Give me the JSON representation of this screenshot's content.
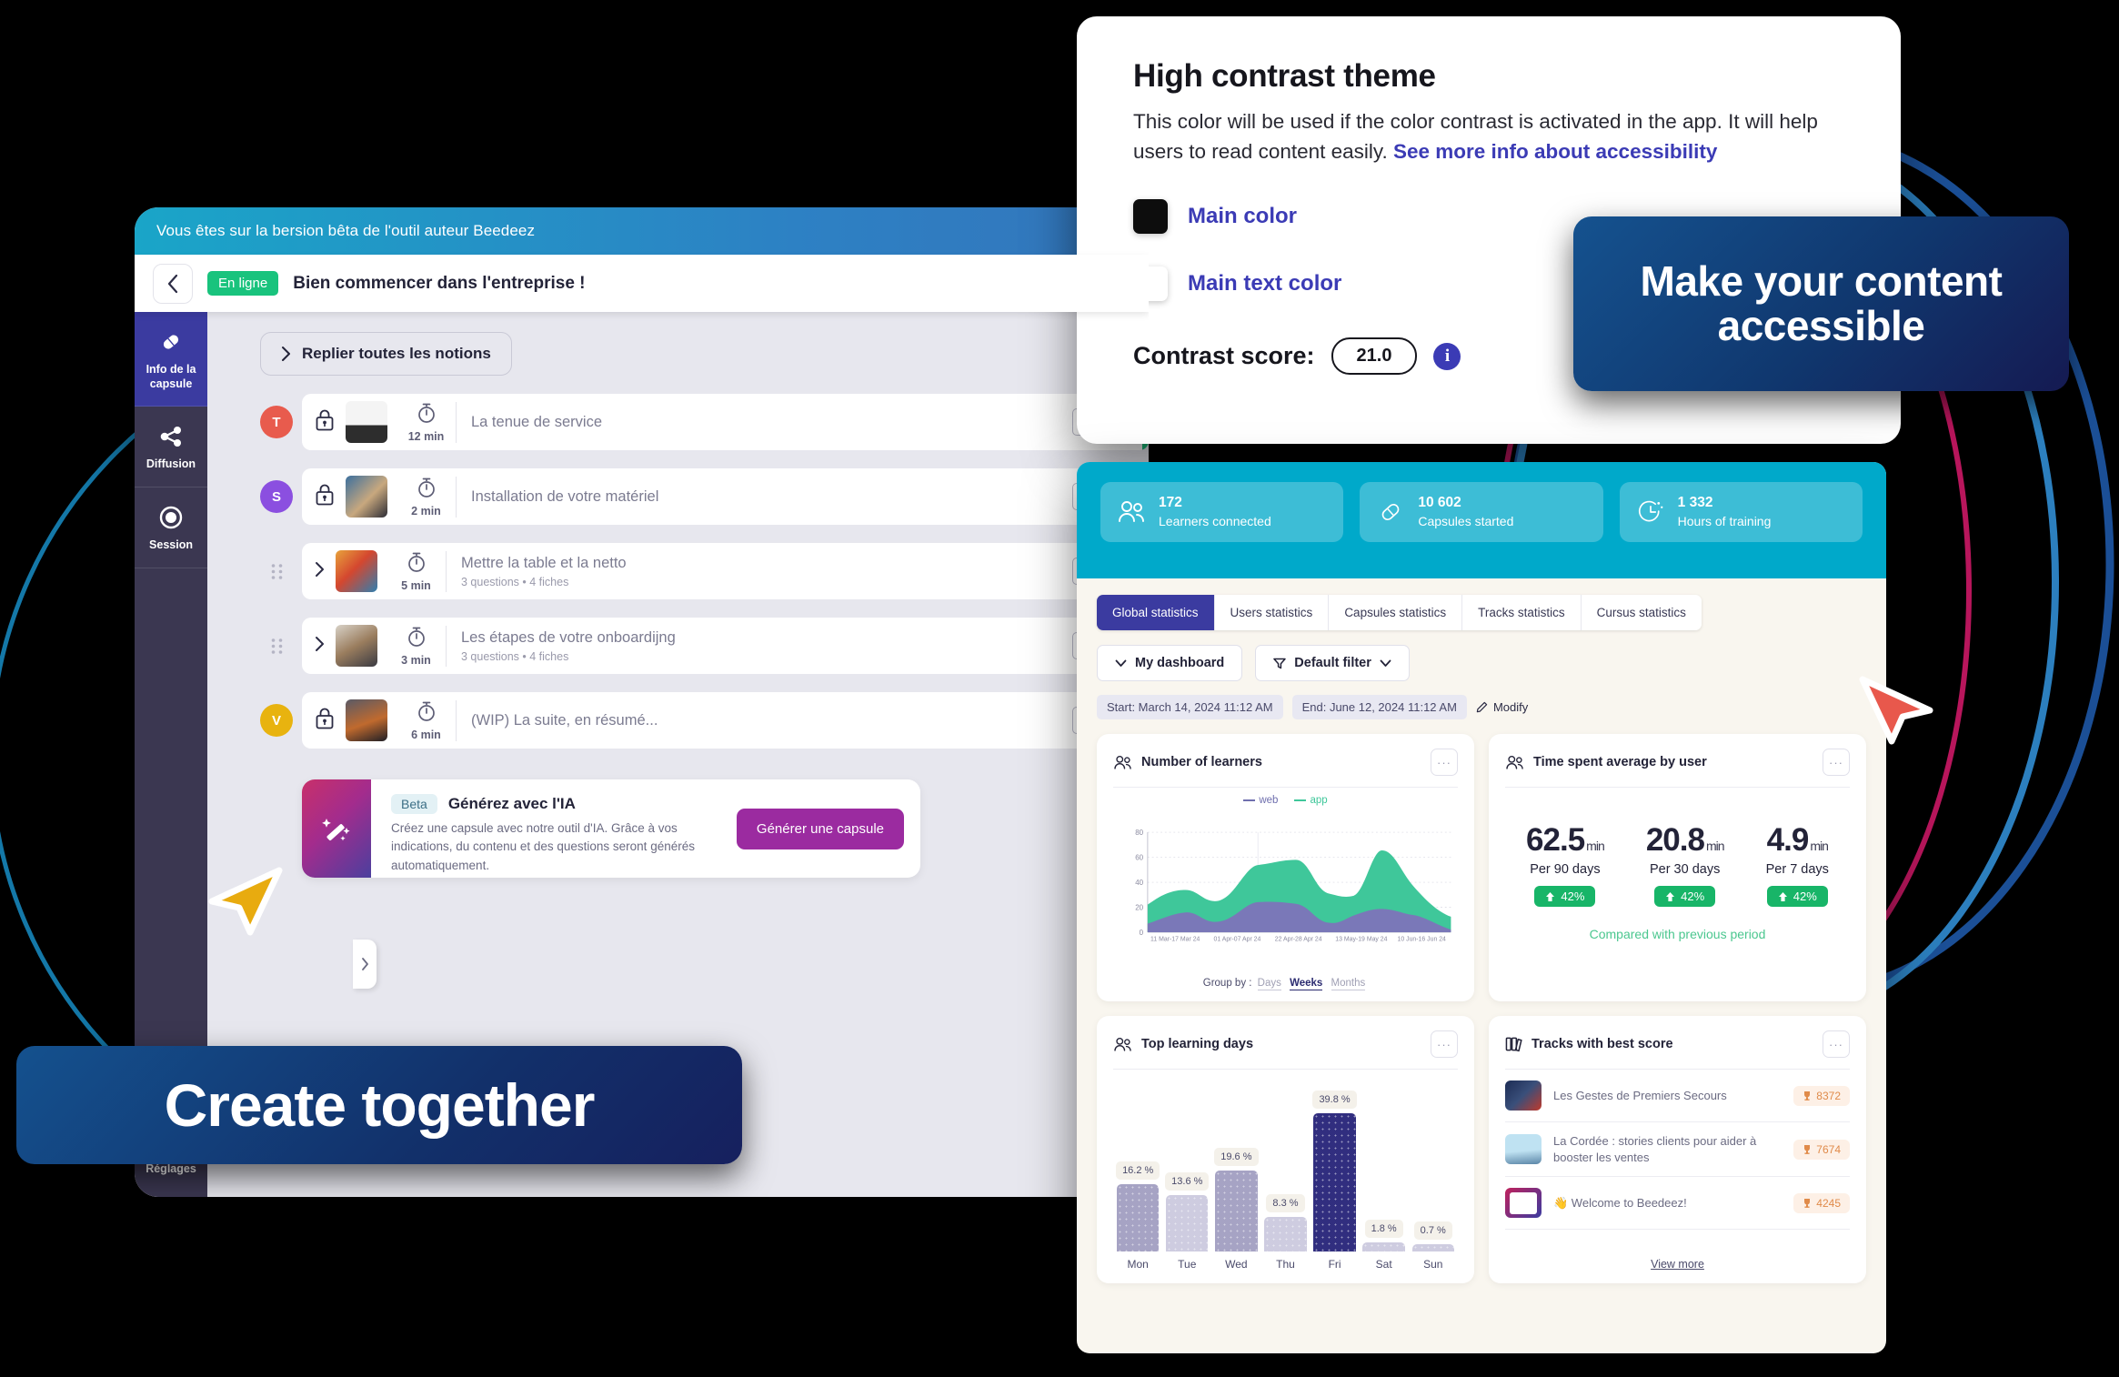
{
  "author": {
    "beta_banner": "Vous êtes sur la bersion bêta de l'outil auteur Beedeez",
    "status_badge": "En ligne",
    "title": "Bien commencer dans l'entreprise !",
    "collapse_button": "Replier toutes les notions",
    "sidebar": {
      "items": [
        {
          "label": "Info de la capsule",
          "icon": "capsule-icon",
          "active": true
        },
        {
          "label": "Diffusion",
          "icon": "share-icon",
          "active": false
        },
        {
          "label": "Session",
          "icon": "session-icon",
          "active": false
        }
      ],
      "bottom_label": "Réglages"
    },
    "notions": [
      {
        "avatar": "T",
        "avatar_color": "#e85b4d",
        "locked": true,
        "expandable": false,
        "duration": "12 min",
        "title": "La tenue de service",
        "sub": "",
        "stripe": "#1bbf7a"
      },
      {
        "avatar": "S",
        "avatar_color": "#8b4fe0",
        "locked": true,
        "expandable": false,
        "duration": "2 min",
        "title": "Installation de votre matériel",
        "sub": "",
        "stripe": "#f0a04b"
      },
      {
        "avatar": "",
        "avatar_color": "",
        "locked": false,
        "expandable": true,
        "duration": "5 min",
        "title": "Mettre la table et la netto",
        "sub": "3 questions  •  4 fiches",
        "stripe": "#d51a4e"
      },
      {
        "avatar": "",
        "avatar_color": "",
        "locked": false,
        "expandable": true,
        "duration": "3 min",
        "title": "Les étapes de votre onboardijng",
        "sub": "3 questions  •  4 fiches",
        "stripe": "#d51a4e"
      },
      {
        "avatar": "V",
        "avatar_color": "#e8b30f",
        "locked": true,
        "expandable": false,
        "duration": "6 min",
        "title": "(WIP) La suite, en résumé...",
        "sub": "",
        "stripe": "#f0a04b"
      }
    ],
    "ai_banner": {
      "beta": "Beta",
      "title": "Générez avec l'IA",
      "description": "Créez une capsule avec notre outil d'IA. Grâce à vos indications, du contenu et des questions seront générés automatiquement.",
      "cta": "Générer une capsule"
    }
  },
  "contrast": {
    "title": "High contrast theme",
    "description": "This color will be used if the color contrast is activated in the app. It will help users to read content easily. ",
    "link": "See more info about accessibility",
    "main_color_label": "Main color",
    "main_color_value": "#0d0d0d",
    "main_text_color_label": "Main text color",
    "main_text_color_value": "#ffffff",
    "score_label": "Contrast score:",
    "score_value": "21.0",
    "info_glyph": "i"
  },
  "dashboard": {
    "kpis": [
      {
        "value": "172",
        "caption": "Learners connected",
        "icon": "users-icon"
      },
      {
        "value": "10 602",
        "caption": "Capsules started",
        "icon": "capsule-icon"
      },
      {
        "value": "1 332",
        "caption": "Hours of training",
        "icon": "clock-icon"
      }
    ],
    "tabs": [
      {
        "label": "Global statistics",
        "active": true
      },
      {
        "label": "Users statistics",
        "active": false
      },
      {
        "label": "Capsules statistics",
        "active": false
      },
      {
        "label": "Tracks statistics",
        "active": false
      },
      {
        "label": "Cursus statistics",
        "active": false
      }
    ],
    "filters": {
      "dashboard_select": "My dashboard",
      "filter_select": "Default filter"
    },
    "date_start": "Start: March 14, 2024 11:12 AM",
    "date_end": "End: June 12, 2024 11:12 AM",
    "modify": "Modify",
    "cards": {
      "learners": {
        "title": "Number of learners",
        "dots": "···"
      },
      "time": {
        "title": "Time spent average by user",
        "dots": "···",
        "stats": [
          {
            "value": "62.5",
            "unit": "min",
            "period": "Per 90 days",
            "delta": "42%"
          },
          {
            "value": "20.8",
            "unit": "min",
            "period": "Per 30 days",
            "delta": "42%"
          },
          {
            "value": "4.9",
            "unit": "min",
            "period": "Per 7 days",
            "delta": "42%"
          }
        ],
        "note": "Compared with previous period"
      },
      "topdays": {
        "title": "Top learning days",
        "dots": "···"
      },
      "tracks": {
        "title": "Tracks with best score",
        "dots": "···",
        "items": [
          {
            "name": "Les Gestes de Premiers Secours",
            "score": "8372"
          },
          {
            "name": "La Cordée : stories clients pour aider à booster les ventes",
            "score": "7674"
          },
          {
            "name": "👋 Welcome to Beedeez!",
            "score": "4245"
          }
        ],
        "view_more": "View more"
      }
    }
  },
  "chart_data": [
    {
      "type": "area",
      "title": "Number of learners",
      "xlabel": "",
      "ylabel": "",
      "ylim": [
        0,
        80
      ],
      "yticks": [
        0,
        20,
        40,
        60,
        80
      ],
      "grid": true,
      "legend_position": "top-center",
      "group_by_label": "Group by :",
      "group_by_options": [
        "Days",
        "Weeks",
        "Months"
      ],
      "group_by_selected": "Weeks",
      "x": [
        "11 Mar-17 Mar 24",
        "01 Apr-07 Apr 24",
        "22 Apr-28 Apr 24",
        "13 May-19 May 24",
        "10 Jun-16 Jun 24"
      ],
      "series": [
        {
          "name": "web",
          "color": "#6f6fae",
          "values": [
            7,
            15,
            9,
            24,
            23,
            8,
            18,
            16,
            3
          ]
        },
        {
          "name": "app",
          "color": "#3fc79a",
          "values": [
            22,
            33,
            25,
            40,
            54,
            22,
            66,
            34,
            12
          ]
        }
      ]
    },
    {
      "type": "bar",
      "title": "Top learning days",
      "xlabel": "",
      "ylabel": "",
      "categories": [
        "Mon",
        "Tue",
        "Wed",
        "Thu",
        "Fri",
        "Sat",
        "Sun"
      ],
      "values": [
        16.2,
        13.6,
        19.6,
        8.3,
        39.8,
        1.8,
        0.7
      ],
      "value_labels": [
        "16.2 %",
        "13.6 %",
        "19.6 %",
        "8.3 %",
        "39.8 %",
        "1.8 %",
        "0.7 %"
      ],
      "colors": [
        "#a6a3c4",
        "#cecce0",
        "#a6a3c4",
        "#cecce0",
        "#312e7f",
        "#cecce0",
        "#cecce0"
      ],
      "ylim": [
        0,
        39.8
      ],
      "grid": false
    }
  ],
  "callouts": {
    "accessible": "Make your content accessible",
    "create": "Create together"
  },
  "colors": {
    "brand_cyan": "#00a9ca",
    "brand_indigo": "#3b3ba0",
    "accent_magenta": "#9b2ba0",
    "cursor_yellow": "#e8ab0f",
    "cursor_red": "#e8584c"
  }
}
